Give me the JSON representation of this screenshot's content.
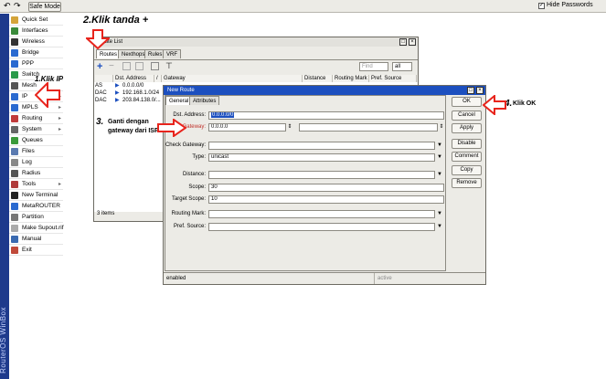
{
  "toolbar": {
    "undo_label": "↶",
    "redo_label": "↷",
    "safe_mode_label": "Safe Mode",
    "hide_passwords_label": "Hide Passwords",
    "hide_passwords_checked": true
  },
  "brand": {
    "vertical_text": "RouterOS WinBox"
  },
  "sidebar": {
    "items": [
      {
        "label": "Quick Set"
      },
      {
        "label": "Interfaces"
      },
      {
        "label": "Wireless"
      },
      {
        "label": "Bridge"
      },
      {
        "label": "PPP"
      },
      {
        "label": "Switch"
      },
      {
        "label": "Mesh"
      },
      {
        "label": "IP"
      },
      {
        "label": "MPLS"
      },
      {
        "label": "Routing"
      },
      {
        "label": "System"
      },
      {
        "label": "Queues"
      },
      {
        "label": "Files"
      },
      {
        "label": "Log"
      },
      {
        "label": "Radius"
      },
      {
        "label": "Tools"
      },
      {
        "label": "New Terminal"
      },
      {
        "label": "MetaROUTER"
      },
      {
        "label": "Partition"
      },
      {
        "label": "Make Supout.rif"
      },
      {
        "label": "Manual"
      },
      {
        "label": "Exit"
      }
    ]
  },
  "route_list": {
    "title": "Route List",
    "tabs": [
      "Routes",
      "Nexthops",
      "Rules",
      "VRF"
    ],
    "find_placeholder": "Find",
    "filter_value": "all",
    "columns": [
      "",
      "Dst. Address",
      "/",
      "Gateway",
      "Distance",
      "Routing Mark",
      "Pref. Source"
    ],
    "rows": [
      {
        "flag": "AS",
        "dst": "0.0.0.0/0"
      },
      {
        "flag": "DAC",
        "dst": "192.168.1.0/24"
      },
      {
        "flag": "DAC",
        "dst": "203.84.138.0/..."
      }
    ],
    "status": "3 items"
  },
  "new_route": {
    "title": "New Route",
    "tabs": [
      "General",
      "Attributes"
    ],
    "fields": {
      "dst_address_label": "Dst. Address:",
      "dst_address_value": "0.0.0.0/0",
      "gateway_label": "Gateway:",
      "gateway_value": "0.0.0.0",
      "check_gateway_label": "Check Gateway:",
      "check_gateway_value": "",
      "type_label": "Type:",
      "type_value": "unicast",
      "distance_label": "Distance:",
      "distance_value": "",
      "scope_label": "Scope:",
      "scope_value": "30",
      "target_scope_label": "Target Scope:",
      "target_scope_value": "10",
      "routing_mark_label": "Routing Mark:",
      "routing_mark_value": "",
      "pref_source_label": "Pref. Source:",
      "pref_source_value": ""
    },
    "buttons": [
      "OK",
      "Cancel",
      "Apply",
      "Disable",
      "Comment",
      "Copy",
      "Remove"
    ],
    "status_left": "enabled",
    "status_right": "active"
  },
  "annotations": {
    "step1": "1.Klik IP",
    "step2": "2.Klik tanda +",
    "step3_line1": "3.",
    "step3_line2": "Ganti dengan",
    "step3_line3": "gateway dari ISP",
    "step4": "4.",
    "step4_text": "Klik OK"
  },
  "colors": {
    "accent_blue": "#1c4fbf",
    "brand_blue": "#1e3a8c",
    "arrow_red": "#e8241c",
    "field_highlight": "#1c4fbf"
  }
}
